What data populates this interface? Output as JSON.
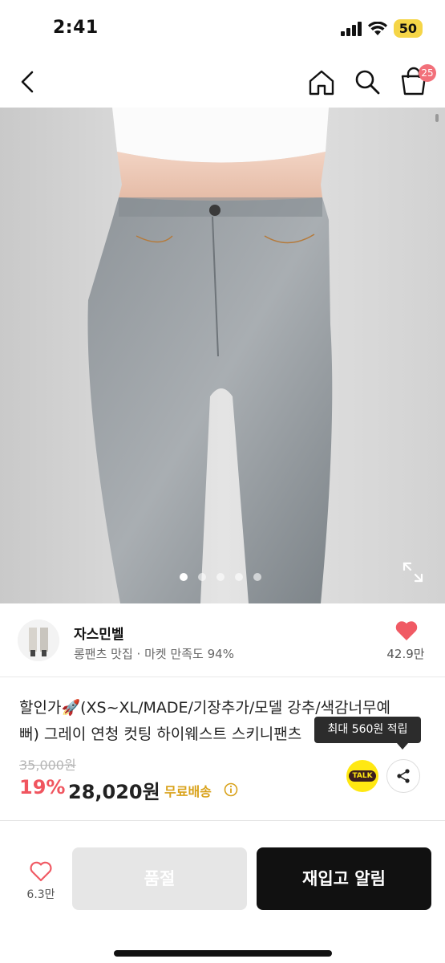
{
  "status_bar": {
    "time": "2:41",
    "battery": "50"
  },
  "nav": {
    "cart_count": "25"
  },
  "gallery": {
    "slide_count": 5,
    "active_index": 0
  },
  "shop": {
    "name": "자스민벨",
    "description": "롱팬츠 맛집 · 마켓 만족도 94%",
    "like_count": "42.9만",
    "like_color": "#f05a64"
  },
  "product": {
    "title_line1": "할인가🚀(XS~XL/MADE/기장추가/모델 강추/색감너무예",
    "title_line2": "뻐) 그레이 연청 컷팅 하이웨스트 스키니팬츠",
    "original_price": "35,000원",
    "discount_rate": "19%",
    "sale_price": "28,020원",
    "shipping": "무료배송",
    "points_tooltip": "최대 560원 적립",
    "talk_label": "TALK"
  },
  "bottom_bar": {
    "like_count": "6.3만",
    "soldout_label": "품절",
    "restock_label": "재입고 알림"
  },
  "colors": {
    "discount": "#f0555f",
    "shipping": "#d9a21b",
    "restock_bg": "#111111",
    "soldout_bg": "#e6e6e6"
  }
}
